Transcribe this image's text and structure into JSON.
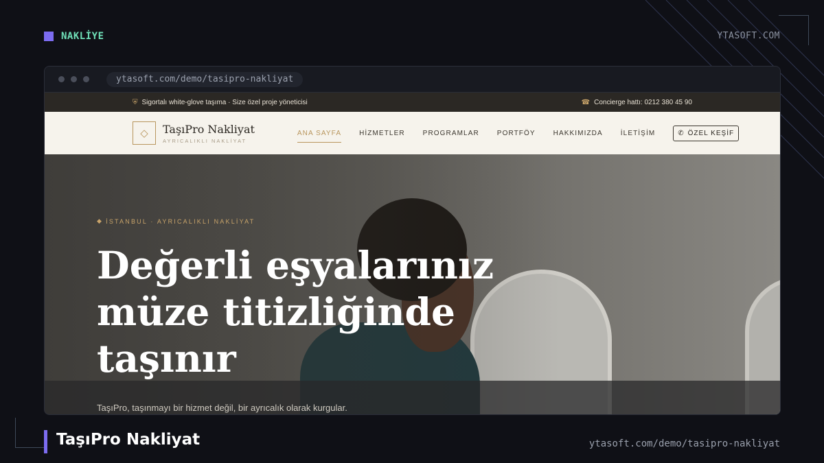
{
  "frame": {
    "category": "NAKLİYE",
    "brand": "YTASOFT.COM",
    "project_title": "TaşıPro Nakliyat",
    "project_url": "ytasoft.com/demo/tasipro-nakliyat"
  },
  "browser": {
    "url": "ytasoft.com/demo/tasipro-nakliyat"
  },
  "site": {
    "topbar": {
      "left_text": "Sigortalı white-glove taşıma · Size özel proje yöneticisi",
      "right_text": "Concierge hattı: 0212 380 45 90"
    },
    "logo": {
      "name": "TaşıPro Nakliyat",
      "tagline": "AYRICALIKLI NAKLİYAT"
    },
    "nav": {
      "items": [
        "ANA SAYFA",
        "HİZMETLER",
        "PROGRAMLAR",
        "PORTFÖY",
        "HAKKIMIZDA",
        "İLETİŞİM"
      ],
      "active_index": 0,
      "cta": "ÖZEL KEŞİF"
    },
    "hero": {
      "eyebrow": "İSTANBUL · AYRICALIKLI NAKLİYAT",
      "title": "Değerli eşyalarınız müze titizliğinde taşınır",
      "subtitle": "TaşıPro, taşınmayı bir hizmet değil, bir ayrıcalık olarak kurgular."
    }
  },
  "colors": {
    "accent_purple": "#7c6cf0",
    "accent_mint": "#6fe0b8",
    "gold": "#b8955c",
    "background": "#0f1016"
  }
}
